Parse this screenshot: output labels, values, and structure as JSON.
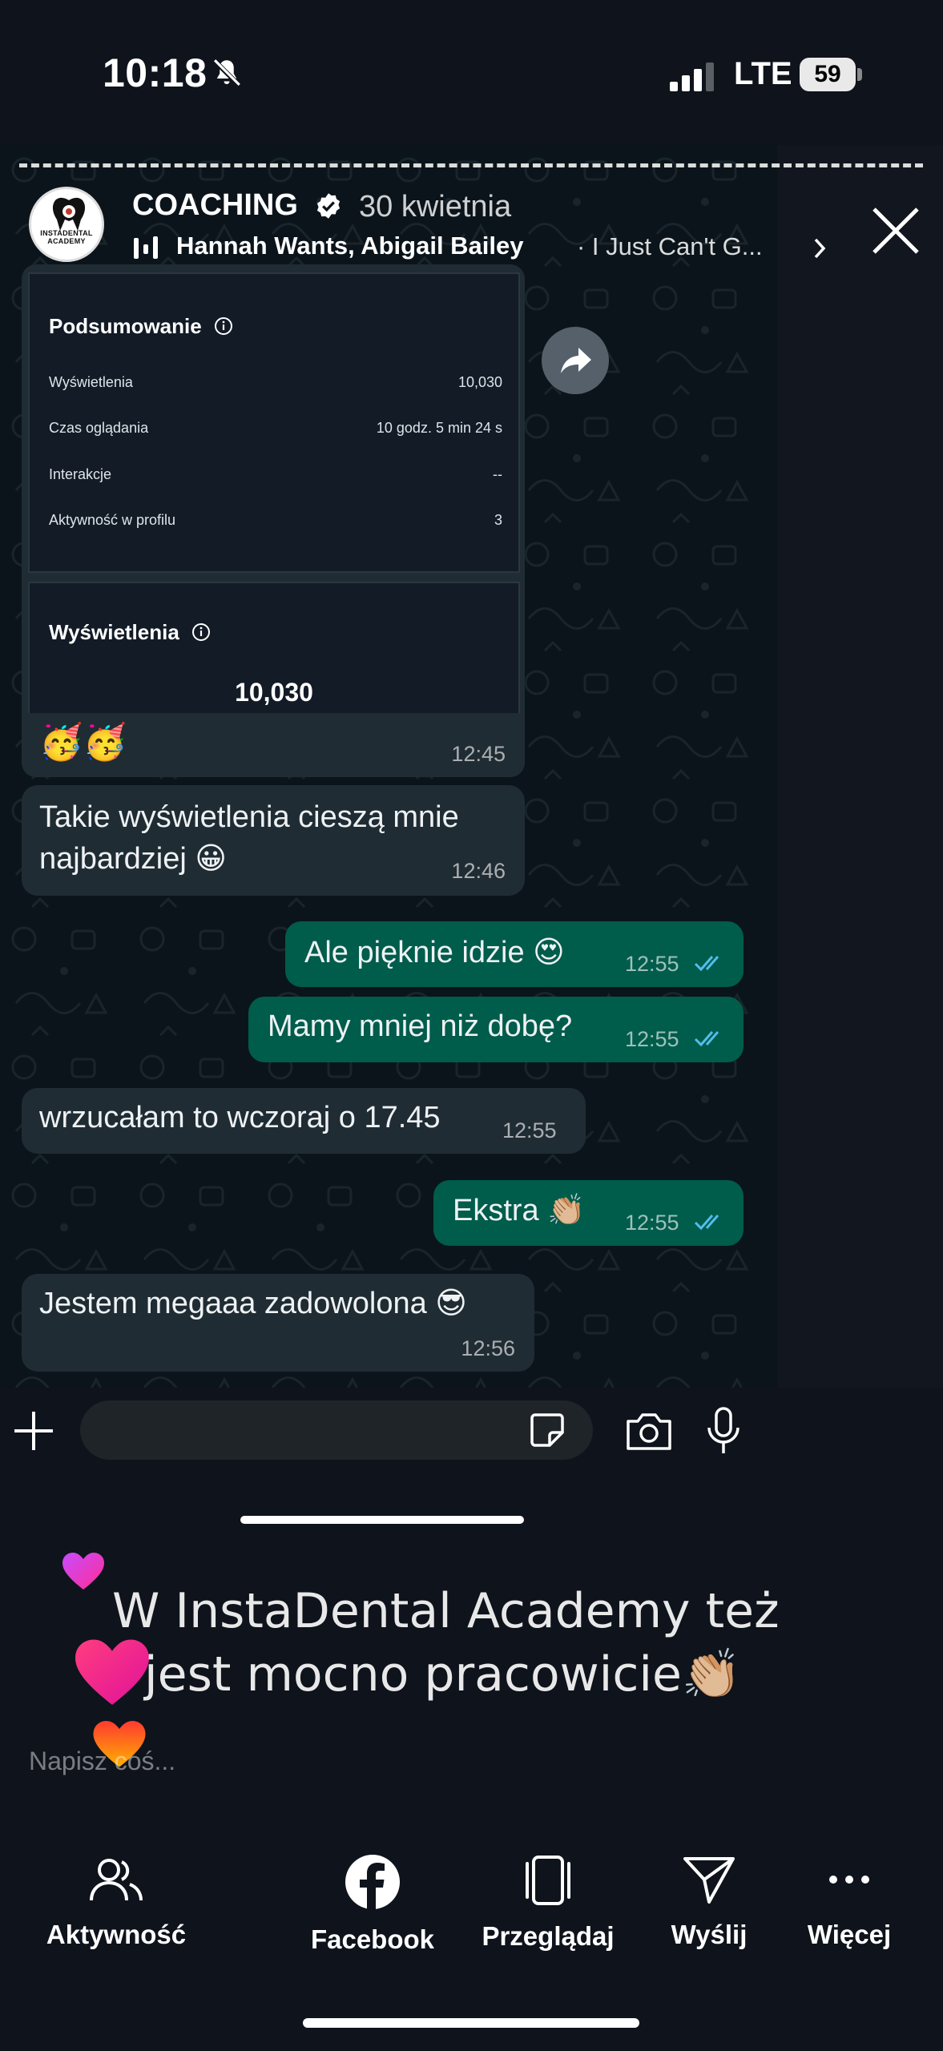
{
  "status_bar": {
    "time": "10:18",
    "network": "LTE",
    "battery": "59"
  },
  "story": {
    "account_name": "COACHING",
    "date": "30 kwietnia",
    "avatar_text": "INSTADENTAL ACADEMY",
    "music": {
      "artists": "Hannah Wants, Abigail Bailey",
      "track": "· I Just Can't G..."
    }
  },
  "insights": {
    "summary_title": "Podsumowanie",
    "rows": [
      {
        "label": "Wyświetlenia",
        "value": "10,030"
      },
      {
        "label": "Czas oglądania",
        "value": "10 godz. 5 min 24 s"
      },
      {
        "label": "Interakcje",
        "value": "--"
      },
      {
        "label": "Aktywność w profilu",
        "value": "3"
      }
    ],
    "views_title": "Wyświetlenia",
    "views_value": "10,030"
  },
  "messages": [
    {
      "dir": "in",
      "text": "🥳🥳",
      "time": "12:45"
    },
    {
      "dir": "in",
      "text": "Takie wyświetlenia cieszą mnie najbardziej 😀",
      "time": "12:46"
    },
    {
      "dir": "out",
      "text": "Ale pięknie idzie 😍",
      "time": "12:55"
    },
    {
      "dir": "out",
      "text": "Mamy mniej niż dobę?",
      "time": "12:55"
    },
    {
      "dir": "in",
      "text": "wrzucałam to wczoraj o 17.45",
      "time": "12:55"
    },
    {
      "dir": "out",
      "text": "Ekstra 👏🏼",
      "time": "12:55"
    },
    {
      "dir": "in",
      "text": "Jestem megaaa zadowolona 😎",
      "time": "12:56"
    }
  ],
  "caption": {
    "line1": "W InstaDental Academy też",
    "line2": "jest mocno pracowicie👏🏼"
  },
  "reply_placeholder": "Napisz coś...",
  "actions": [
    {
      "label": "Aktywność",
      "icon": "people-icon"
    },
    {
      "label": "Facebook",
      "icon": "facebook-icon"
    },
    {
      "label": "Przeglądaj",
      "icon": "browse-icon"
    },
    {
      "label": "Wyślij",
      "icon": "send-icon"
    },
    {
      "label": "Więcej",
      "icon": "more-icon"
    }
  ],
  "colors": {
    "incoming_bubble": "#202c33",
    "outgoing_bubble": "#005c4b",
    "read_ticks": "#53bdeb"
  }
}
